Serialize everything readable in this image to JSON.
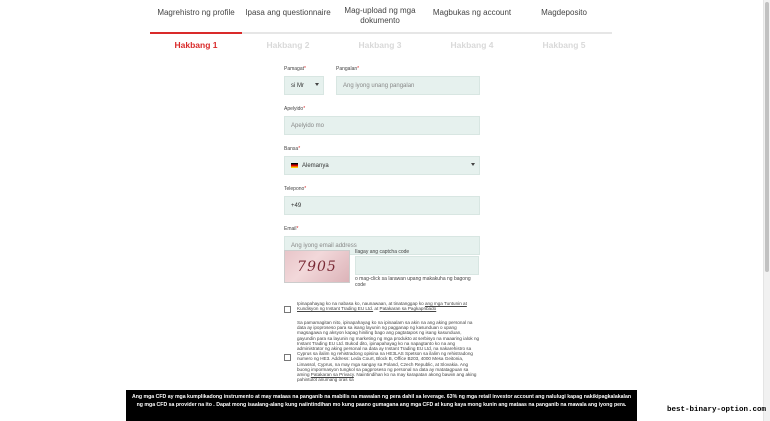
{
  "steps": [
    {
      "title": "Magrehistro ng profile",
      "num": "Hakbang 1",
      "active": true
    },
    {
      "title": "Ipasa ang questionnaire",
      "num": "Hakbang 2",
      "active": false
    },
    {
      "title": "Mag-upload ng mga dokumento",
      "num": "Hakbang 3",
      "active": false
    },
    {
      "title": "Magbukas ng account",
      "num": "Hakbang 4",
      "active": false
    },
    {
      "title": "Magdeposito",
      "num": "Hakbang 5",
      "active": false
    }
  ],
  "form": {
    "title_label": "Pamagat",
    "title_value": "si Mr",
    "firstname_label": "Pangalan",
    "firstname_placeholder": "Ang iyong unang pangalan",
    "lastname_label": "Apelyido",
    "lastname_placeholder": "Apelyido mo",
    "country_label": "Bansa",
    "country_value": "Alemanya",
    "phone_label": "Telepono",
    "phone_value": "+49",
    "email_label": "Email",
    "email_placeholder": "Ang iyong email address",
    "captcha_label": "Ilagay ang captcha code",
    "captcha_text": "7905",
    "captcha_hint": "o mag-click sa larawan upang makakuha ng bagong code",
    "required_mark": "*"
  },
  "consent": {
    "first_text_a": "Ipinapahayag ko na nabasa ko, naunawaan, at tinatanggap ko",
    "first_link": "ang mga Tuntunin at Kundisyon ng Instant Trading EU Ltd.",
    "first_text_b": "at",
    "first_link2": "Patakaran sa Pagkapribado",
    "second_text": "Sa pamamagitan nito, ipinapahayag ko na ipinaalam sa akin na ang aking personal na data ay ipoproseso para sa isang layunin ng pagganap ng kasunduan o upang magsagawa ng aksyon kapag hiniling bago ang pagtatapos ng isang kasunduan, gayundin para sa layunin ng marketing ng mga produkto at serbisyo na maaaring ialok ng Instant Trading EU Ltd. Bukod dito, ipinapahayag ko na napagtanto ko na ang administrator ng aking personal na data ay Instant Trading EU Ltd, na nakarehistro sa Cyprus sa ilalim ng rehistradong opisina na HE3LAS Spetson sa ilalim ng rehistradong numero ng HE3. Address: Leda Court, Block B, Office B203, 4000 Mesa Geitonia, Limassol, Cyprus, na may mga sangay sa Poland, Czech Republic, at Slovakia. Ang buong impormasyon tungkol sa pagproseso ng personal na data ay matatagpuan sa aming",
    "second_link": "Patakaran sa Privacy",
    "second_text_b": ". Naiintindihan ko na may karapatan akong bawiin ang aking pahintulot anumang oras sa"
  },
  "banner": {
    "text": "Ang mga CFD ay mga kumplikadong instrumento at may mataas na panganib na mabilis na mawalan ng pera dahil sa leverage. 63% ng mga retail investor account ang nalulugi kapag nakikipagkalakalan ng mga CFD sa provider na ito . Dapat mong isaalang-alang kung naiintindihan mo kung paano gumagana ang mga CFD at kung kaya mong kunin ang mataas na panganib na mawala ang iyong pera."
  },
  "watermark": "best-binary-option.com",
  "colors": {
    "accent": "#d92a2a",
    "field_bg": "#e6f1ee"
  }
}
